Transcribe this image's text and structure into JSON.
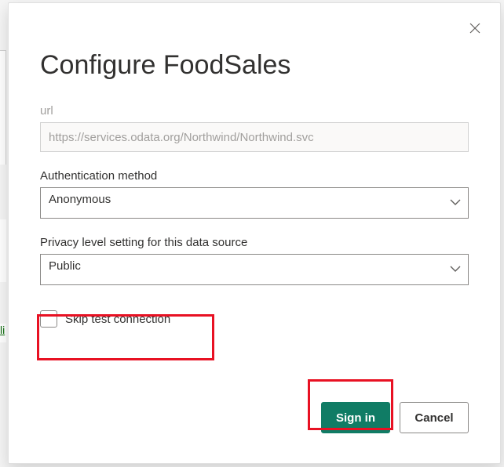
{
  "backdrop": {
    "link_fragment": "li"
  },
  "dialog": {
    "title": "Configure FoodSales",
    "url": {
      "label": "url",
      "value": "https://services.odata.org/Northwind/Northwind.svc"
    },
    "auth": {
      "label": "Authentication method",
      "value": "Anonymous"
    },
    "privacy": {
      "label": "Privacy level setting for this data source",
      "value": "Public"
    },
    "skip": {
      "label": "Skip test connection"
    },
    "actions": {
      "signin": "Sign in",
      "cancel": "Cancel"
    }
  }
}
